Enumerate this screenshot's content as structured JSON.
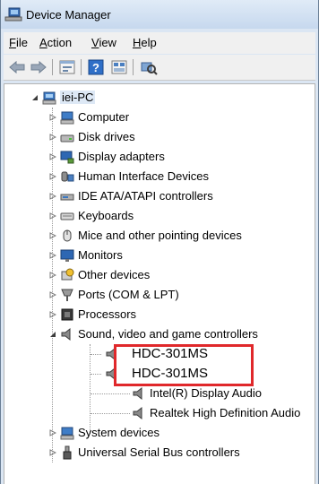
{
  "window": {
    "title": "Device Manager"
  },
  "menu": [
    {
      "key": "file",
      "label": "File",
      "accel": "F",
      "rest": "ile"
    },
    {
      "key": "action",
      "label": "Action",
      "accel": "A",
      "rest": "ction"
    },
    {
      "key": "view",
      "label": "View",
      "accel": "V",
      "rest": "iew"
    },
    {
      "key": "help",
      "label": "Help",
      "accel": "H",
      "rest": "elp"
    }
  ],
  "toolbar": {
    "back_icon": "back-arrow-icon",
    "forward_icon": "forward-arrow-icon",
    "properties_icon": "properties-icon",
    "help_icon": "help-icon",
    "update_icon": "update-driver-icon",
    "scan_icon": "scan-hardware-icon"
  },
  "tree": {
    "root": "iei-PC",
    "categories": [
      "Computer",
      "Disk drives",
      "Display adapters",
      "Human Interface Devices",
      "IDE ATA/ATAPI controllers",
      "Keyboards",
      "Mice and other pointing devices",
      "Monitors",
      "Other devices",
      "Ports (COM & LPT)",
      "Processors",
      "Sound, video and game controllers",
      "System devices",
      "Universal Serial Bus controllers"
    ],
    "sound_children": [
      "HDC-301MS",
      "HDC-301MS",
      "Intel(R) Display Audio",
      "Realtek High Definition Audio"
    ]
  },
  "colors": {
    "highlight": "#e0282b",
    "title_gradient_top": "#e0ebf7",
    "title_gradient_bottom": "#c6d8ee"
  }
}
